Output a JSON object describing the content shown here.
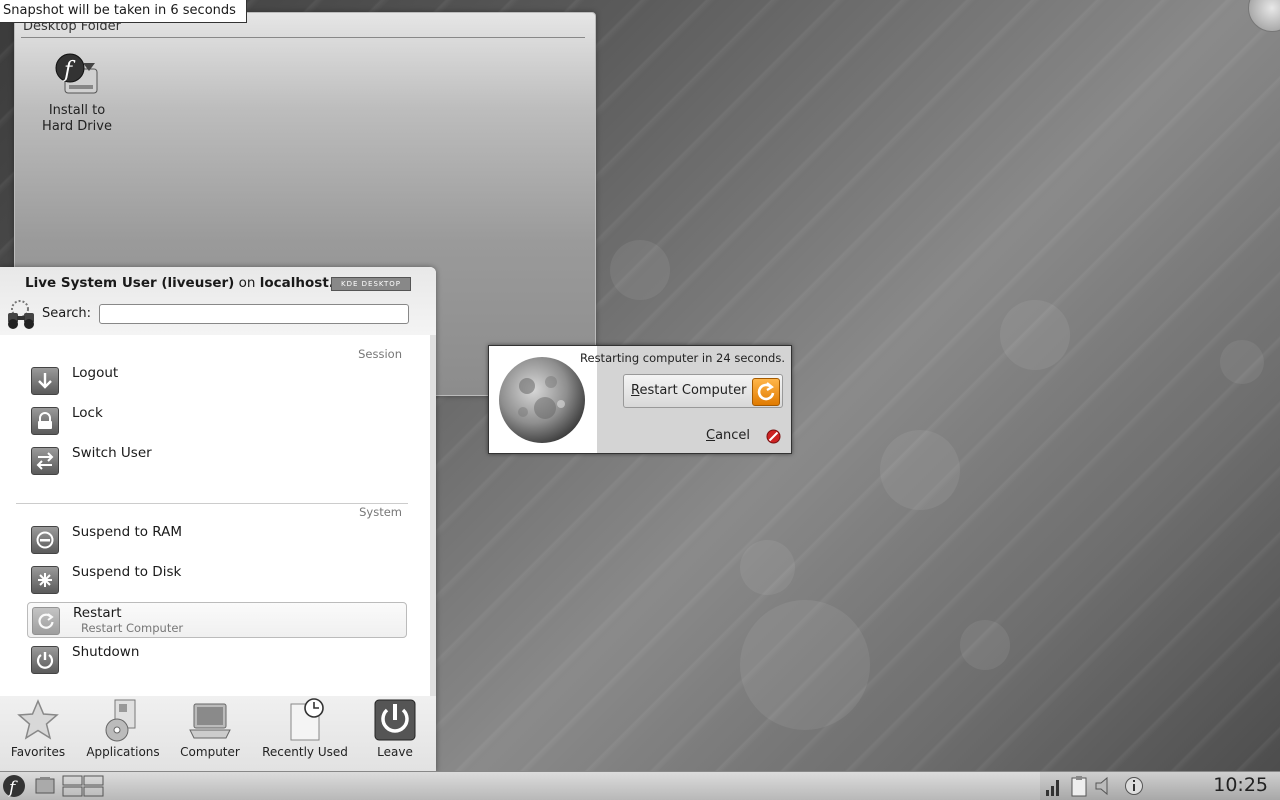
{
  "snapshot": {
    "text": "Snapshot will be taken in 6 seconds"
  },
  "desktop_folder": {
    "title": "Desktop Folder",
    "icon": {
      "name": "fedora-install-icon",
      "label_line1": "Install to",
      "label_line2": "Hard Drive"
    }
  },
  "kickoff": {
    "user_name": "Live System User (liveuser)",
    "user_on": "on",
    "host": "localhost.",
    "badge": "KDE DESKTOP",
    "search_label": "Search:",
    "search_value": "",
    "session_label": "Session",
    "system_label": "System",
    "session_items": [
      {
        "label": "Logout",
        "icon": "logout-arrow-icon"
      },
      {
        "label": "Lock",
        "icon": "lock-icon"
      },
      {
        "label": "Switch User",
        "icon": "switch-user-icon"
      }
    ],
    "system_items": [
      {
        "label": "Suspend to RAM",
        "icon": "suspend-ram-icon"
      },
      {
        "label": "Suspend to Disk",
        "icon": "suspend-disk-icon"
      },
      {
        "label": "Restart",
        "sub": "Restart Computer",
        "icon": "restart-icon"
      },
      {
        "label": "Shutdown",
        "icon": "shutdown-icon"
      }
    ],
    "tabs": [
      {
        "label": "Favorites",
        "icon": "star-icon"
      },
      {
        "label": "Applications",
        "icon": "applications-icon"
      },
      {
        "label": "Computer",
        "icon": "computer-icon"
      },
      {
        "label": "Recently Used",
        "icon": "recently-used-icon"
      },
      {
        "label": "Leave",
        "icon": "leave-icon"
      }
    ]
  },
  "dialog": {
    "message": "Restarting computer in 24 seconds.",
    "restart_button_first": "R",
    "restart_button_rest": "estart Computer",
    "cancel_button_first": "C",
    "cancel_button_rest": "ancel"
  },
  "taskbar": {
    "clock": "10:25"
  },
  "colors": {
    "restart_icon": "#f0930f",
    "cancel_icon": "#cc2222",
    "panel": "#c8c8c8"
  }
}
